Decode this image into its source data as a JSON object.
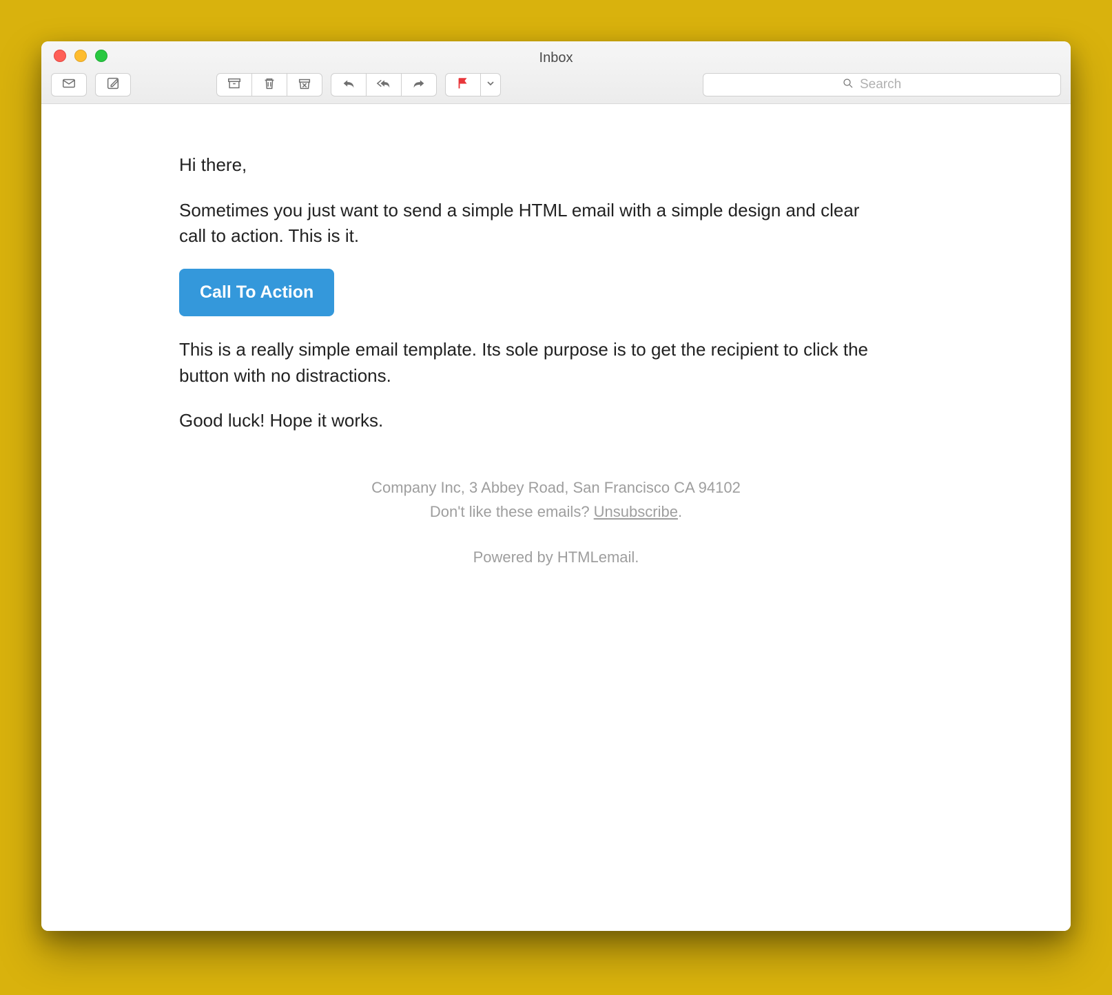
{
  "window": {
    "title": "Inbox"
  },
  "search": {
    "placeholder": "Search"
  },
  "email": {
    "greeting": "Hi there,",
    "intro": "Sometimes you just want to send a simple HTML email with a simple design and clear call to action. This is it.",
    "cta_label": "Call To Action",
    "body2": "This is a really simple email template. Its sole purpose is to get the recipient to click the button with no distractions.",
    "signoff": "Good luck! Hope it works."
  },
  "footer": {
    "address": "Company Inc, 3 Abbey Road, San Francisco CA 94102",
    "unsubscribe_lead": "Don't like these emails? ",
    "unsubscribe_label": "Unsubscribe",
    "powered": "Powered by HTMLemail."
  }
}
